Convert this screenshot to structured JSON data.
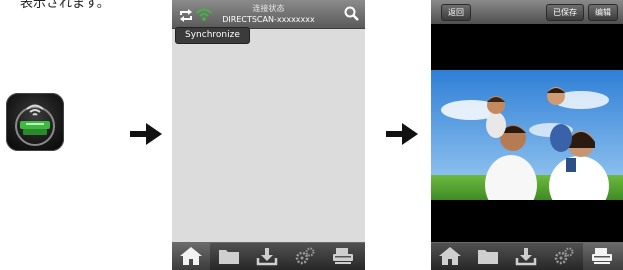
{
  "caption": "表示されます。",
  "phone1": {
    "status_title": "连接状态",
    "device_name": "DIRECTSCAN-xxxxxxxx",
    "sync_label": "Synchronize",
    "tabs": [
      {
        "icon": "home-icon",
        "active": true
      },
      {
        "icon": "folder-icon",
        "active": false
      },
      {
        "icon": "download-icon",
        "active": false
      },
      {
        "icon": "settings-gears-icon",
        "active": false
      },
      {
        "icon": "scanner-icon",
        "active": false
      }
    ]
  },
  "phone2": {
    "back_label": "返回",
    "saved_label": "已保存",
    "edit_label": "编辑",
    "tabs": [
      {
        "icon": "home-icon",
        "active": false
      },
      {
        "icon": "folder-icon",
        "active": false
      },
      {
        "icon": "download-icon",
        "active": false
      },
      {
        "icon": "settings-gears-icon",
        "active": false
      },
      {
        "icon": "scanner-icon",
        "active": true
      }
    ]
  },
  "colors": {
    "wifi_green": "#3fb83f",
    "sky_blue": "#4d9be0",
    "grass_green": "#5fae3a"
  }
}
